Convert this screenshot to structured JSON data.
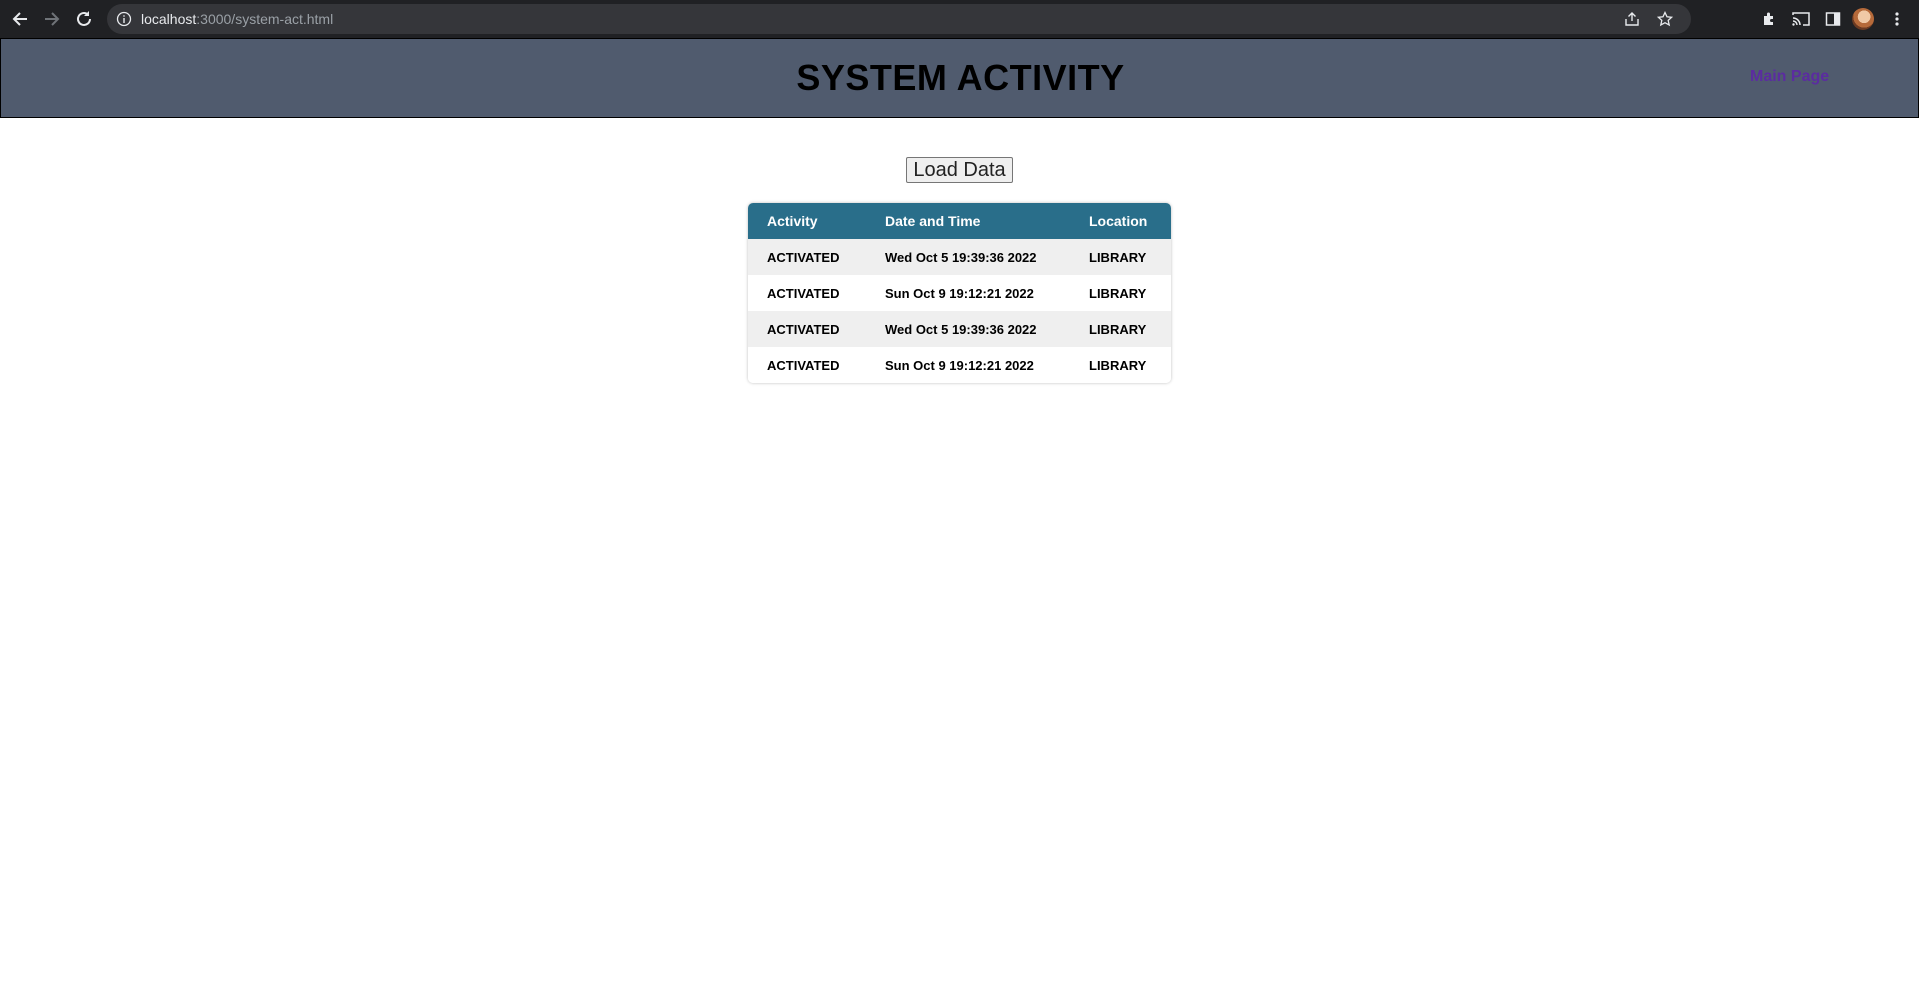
{
  "browser": {
    "url_host": "localhost",
    "url_rest": ":3000/system-act.html"
  },
  "header": {
    "title": "SYSTEM ACTIVITY",
    "main_link": "Main Page"
  },
  "load_button": "Load Data",
  "table": {
    "columns": [
      "Activity",
      "Date and Time",
      "Location"
    ],
    "rows": [
      [
        "ACTIVATED",
        "Wed Oct 5 19:39:36 2022",
        "LIBRARY"
      ],
      [
        "ACTIVATED",
        "Sun Oct 9 19:12:21 2022",
        "LIBRARY"
      ],
      [
        "ACTIVATED",
        "Wed Oct 5 19:39:36 2022",
        "LIBRARY"
      ],
      [
        "ACTIVATED",
        "Sun Oct 9 19:12:21 2022",
        "LIBRARY"
      ]
    ]
  },
  "icons": {
    "back": "back-arrow-icon",
    "forward": "forward-arrow-icon",
    "reload": "reload-icon",
    "site_info": "info-icon",
    "share": "share-icon",
    "bookmark": "star-icon",
    "extensions": "puzzle-icon",
    "cast": "cast-icon",
    "side_panel": "side-panel-icon",
    "menu": "kebab-menu-icon"
  },
  "colors": {
    "header_bg": "#505b6e",
    "table_header_bg": "#296e8a",
    "link": "#5b2ca0"
  }
}
